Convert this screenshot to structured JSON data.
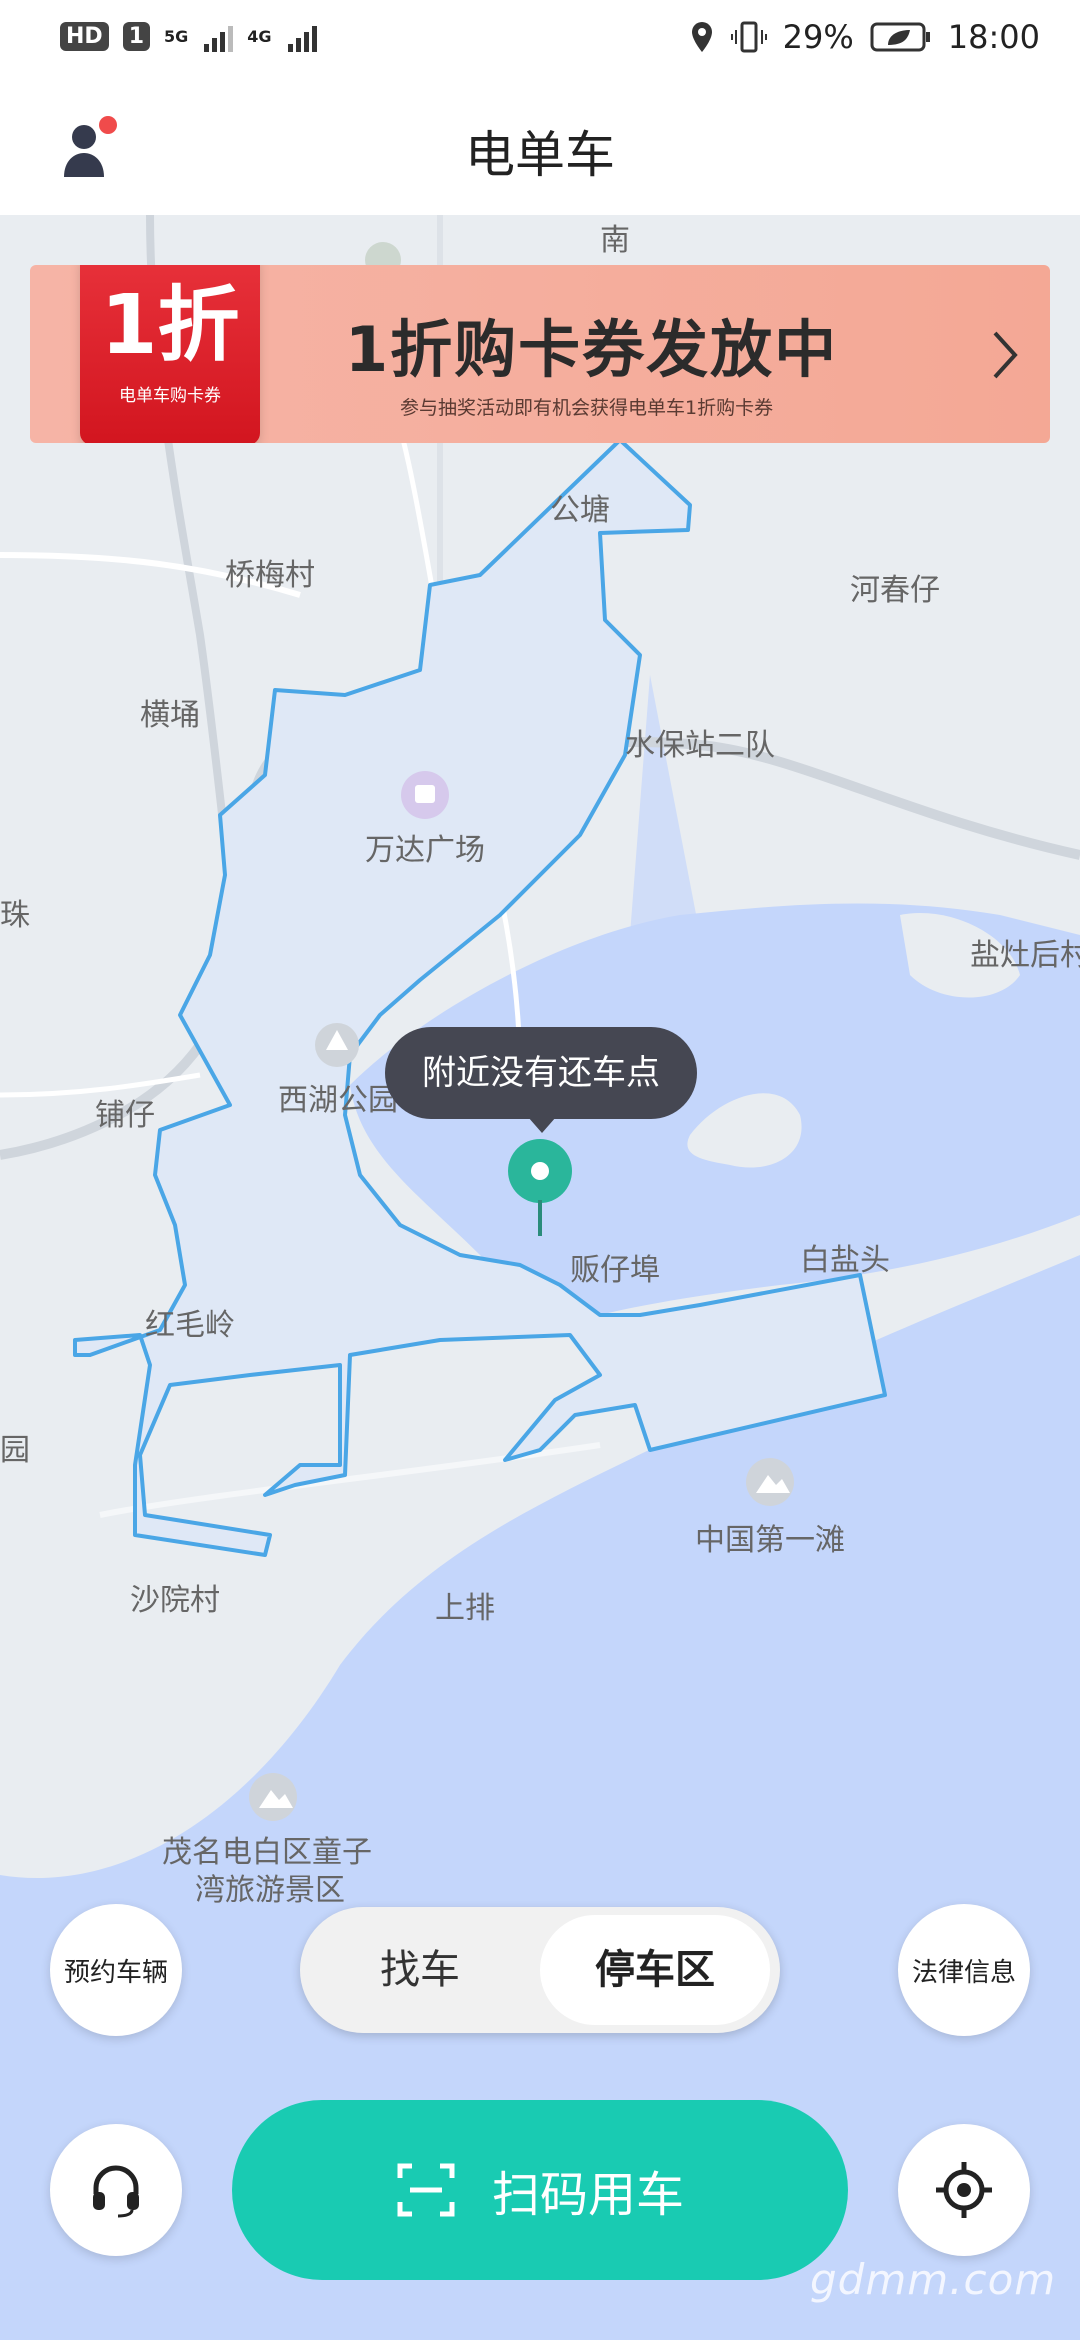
{
  "status_bar": {
    "hd_badge": "HD",
    "sim_slot": "1",
    "net_type_1": "5G",
    "net_type_2": "4G",
    "battery": "29%",
    "time": "18:00"
  },
  "header": {
    "title": "电单车"
  },
  "banner": {
    "coupon_big": "1折",
    "coupon_small": "电单车购卡券",
    "title": "1折购卡券发放中",
    "subtitle": "参与抽奖活动即有机会获得电单车1折购卡券"
  },
  "map": {
    "places": {
      "nan": "南",
      "gongtang": "公塘",
      "qiaomeicun": "桥梅村",
      "hechunzai": "河春仔",
      "hengyong": "横埇",
      "shuibaozhan": "水保站二队",
      "wanda": "万达广场",
      "yanzaohou": "盐灶后村",
      "zhu": "珠",
      "puzai": "铺仔",
      "xihu": "西湖公园",
      "fanzaibu": "贩仔埠",
      "baiyantou": "白盐头",
      "hongmaoling": "红毛岭",
      "yuan": "园",
      "zhongguo": "中国第一滩",
      "shayuancun": "沙院村",
      "shangpai": "上排",
      "maoming_1": "茂名电白区童子",
      "maoming_2": "湾旅游景区"
    },
    "tooltip": "附近没有还车点"
  },
  "controls": {
    "reserve": "预约车辆",
    "legal": "法律信息",
    "seg_find": "找车",
    "seg_park": "停车区",
    "scan": "扫码用车"
  },
  "watermark": "gdmm.com",
  "colors": {
    "accent": "#19cbb2",
    "water": "#c4d6fb",
    "zone_stroke": "#4aa6e6",
    "zone_fill": "#dfe8f6"
  }
}
